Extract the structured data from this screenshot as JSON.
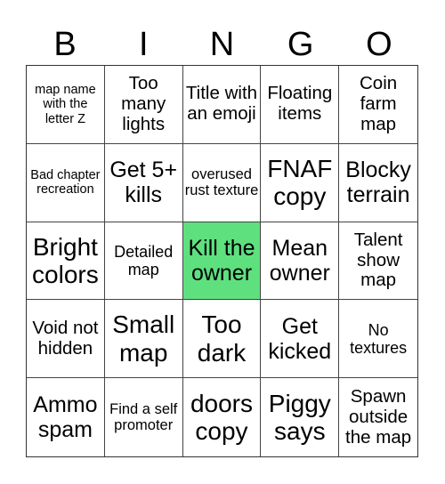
{
  "header": {
    "letters": [
      "B",
      "I",
      "N",
      "G",
      "O"
    ]
  },
  "marked_color": "#5ee07f",
  "cells": [
    {
      "text": "map name with the letter Z",
      "size": "s14",
      "marked": false
    },
    {
      "text": "Too many lights",
      "size": "s20",
      "marked": false
    },
    {
      "text": "Title with an emoji",
      "size": "s20",
      "marked": false
    },
    {
      "text": "Floating items",
      "size": "s20",
      "marked": false
    },
    {
      "text": "Coin farm map",
      "size": "s20",
      "marked": false
    },
    {
      "text": "Bad chapter recreation",
      "size": "s14",
      "marked": false
    },
    {
      "text": "Get 5+ kills",
      "size": "s24",
      "marked": false
    },
    {
      "text": "overused rust texture",
      "size": "s16",
      "marked": false
    },
    {
      "text": "FNAF copy",
      "size": "s28",
      "marked": false
    },
    {
      "text": "Blocky terrain",
      "size": "s24",
      "marked": false
    },
    {
      "text": "Bright colors",
      "size": "s28",
      "marked": false
    },
    {
      "text": "Detailed map",
      "size": "s18",
      "marked": false
    },
    {
      "text": "Kill the owner",
      "size": "s24",
      "marked": true
    },
    {
      "text": "Mean owner",
      "size": "s24",
      "marked": false
    },
    {
      "text": "Talent show map",
      "size": "s20",
      "marked": false
    },
    {
      "text": "Void not hidden",
      "size": "s20",
      "marked": false
    },
    {
      "text": "Small map",
      "size": "s28",
      "marked": false
    },
    {
      "text": "Too dark",
      "size": "s28",
      "marked": false
    },
    {
      "text": "Get kicked",
      "size": "s24",
      "marked": false
    },
    {
      "text": "No textures",
      "size": "s18",
      "marked": false
    },
    {
      "text": "Ammo spam",
      "size": "s24",
      "marked": false
    },
    {
      "text": "Find a self promoter",
      "size": "s16",
      "marked": false
    },
    {
      "text": "doors copy",
      "size": "s28",
      "marked": false
    },
    {
      "text": "Piggy says",
      "size": "s28",
      "marked": false
    },
    {
      "text": "Spawn outside the map",
      "size": "s20",
      "marked": false
    }
  ]
}
